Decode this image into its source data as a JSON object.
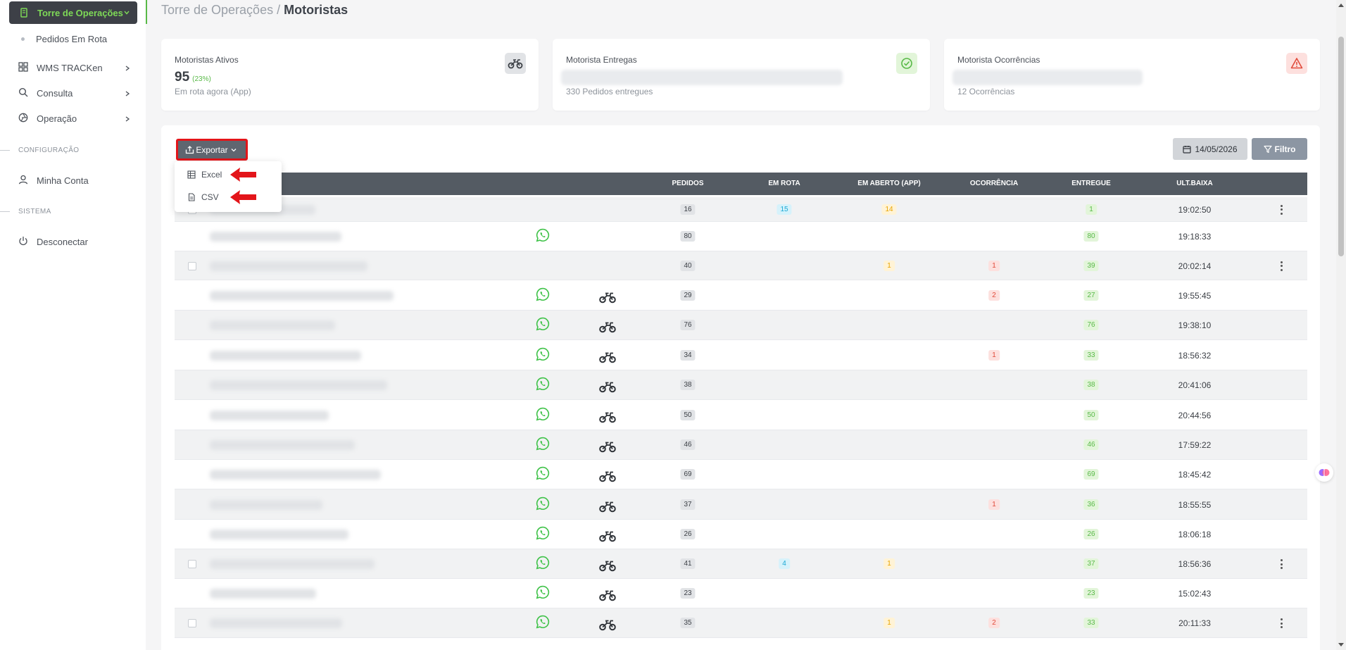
{
  "sidebar": {
    "active_menu": "Torre de Operações",
    "active_sub": "Pedidos Em Rota",
    "items": [
      {
        "label": "WMS TRACKen"
      },
      {
        "label": "Consulta"
      },
      {
        "label": "Operação"
      }
    ],
    "section_config": "CONFIGURAÇÃO",
    "account": "Minha Conta",
    "section_system": "SISTEMA",
    "logout": "Desconectar"
  },
  "breadcrumb": {
    "parent": "Torre de Operações / ",
    "current": "Motoristas"
  },
  "cards": {
    "ativos": {
      "label": "Motoristas Ativos",
      "value": "95",
      "pct": "(23%)",
      "sub": "Em rota agora (App)"
    },
    "entregas": {
      "label": "Motorista Entregas",
      "sub": "330 Pedidos entregues"
    },
    "ocorrencias": {
      "label": "Motorista Ocorrências",
      "sub": "12 Ocorrências"
    }
  },
  "toolbar": {
    "export_label": "Exportar",
    "date_label": "14/05/2026",
    "filter_label": "Filtro"
  },
  "export_menu": {
    "excel": "Excel",
    "csv": "CSV"
  },
  "table": {
    "columns": {
      "pedidos": "PEDIDOS",
      "em_rota": "EM ROTA",
      "em_aberto": "EM ABERTO (APP)",
      "ocorrencia": "OCORRÊNCIA",
      "entregue": "ENTREGUE",
      "ult_baixa": "ULT.BAIXA"
    },
    "rows": [
      {
        "pedidos": "16",
        "em_rota": "15",
        "em_aberto": "14",
        "ocorrencia": "",
        "entregue": "1",
        "ult_baixa": "19:02:50",
        "checkbox": true,
        "whatsapp": false,
        "moto": false,
        "menu": true
      },
      {
        "pedidos": "80",
        "em_rota": "",
        "em_aberto": "",
        "ocorrencia": "",
        "entregue": "80",
        "ult_baixa": "19:18:33",
        "checkbox": false,
        "whatsapp": true,
        "moto": false,
        "menu": false
      },
      {
        "pedidos": "40",
        "em_rota": "",
        "em_aberto": "1",
        "ocorrencia": "1",
        "entregue": "39",
        "ult_baixa": "20:02:14",
        "checkbox": true,
        "whatsapp": false,
        "moto": false,
        "menu": true
      },
      {
        "pedidos": "29",
        "em_rota": "",
        "em_aberto": "",
        "ocorrencia": "2",
        "entregue": "27",
        "ult_baixa": "19:55:45",
        "checkbox": false,
        "whatsapp": true,
        "moto": true,
        "menu": false
      },
      {
        "pedidos": "76",
        "em_rota": "",
        "em_aberto": "",
        "ocorrencia": "",
        "entregue": "76",
        "ult_baixa": "19:38:10",
        "checkbox": false,
        "whatsapp": true,
        "moto": true,
        "menu": false
      },
      {
        "pedidos": "34",
        "em_rota": "",
        "em_aberto": "",
        "ocorrencia": "1",
        "entregue": "33",
        "ult_baixa": "18:56:32",
        "checkbox": false,
        "whatsapp": true,
        "moto": true,
        "menu": false
      },
      {
        "pedidos": "38",
        "em_rota": "",
        "em_aberto": "",
        "ocorrencia": "",
        "entregue": "38",
        "ult_baixa": "20:41:06",
        "checkbox": false,
        "whatsapp": true,
        "moto": true,
        "menu": false
      },
      {
        "pedidos": "50",
        "em_rota": "",
        "em_aberto": "",
        "ocorrencia": "",
        "entregue": "50",
        "ult_baixa": "20:44:56",
        "checkbox": false,
        "whatsapp": true,
        "moto": true,
        "menu": false
      },
      {
        "pedidos": "46",
        "em_rota": "",
        "em_aberto": "",
        "ocorrencia": "",
        "entregue": "46",
        "ult_baixa": "17:59:22",
        "checkbox": false,
        "whatsapp": true,
        "moto": true,
        "menu": false
      },
      {
        "pedidos": "69",
        "em_rota": "",
        "em_aberto": "",
        "ocorrencia": "",
        "entregue": "69",
        "ult_baixa": "18:45:42",
        "checkbox": false,
        "whatsapp": true,
        "moto": true,
        "menu": false
      },
      {
        "pedidos": "37",
        "em_rota": "",
        "em_aberto": "",
        "ocorrencia": "1",
        "entregue": "36",
        "ult_baixa": "18:55:55",
        "checkbox": false,
        "whatsapp": true,
        "moto": true,
        "menu": false
      },
      {
        "pedidos": "26",
        "em_rota": "",
        "em_aberto": "",
        "ocorrencia": "",
        "entregue": "26",
        "ult_baixa": "18:06:18",
        "checkbox": false,
        "whatsapp": true,
        "moto": true,
        "menu": false
      },
      {
        "pedidos": "41",
        "em_rota": "4",
        "em_aberto": "1",
        "ocorrencia": "",
        "entregue": "37",
        "ult_baixa": "18:56:36",
        "checkbox": true,
        "whatsapp": true,
        "moto": true,
        "menu": true
      },
      {
        "pedidos": "23",
        "em_rota": "",
        "em_aberto": "",
        "ocorrencia": "",
        "entregue": "23",
        "ult_baixa": "15:02:43",
        "checkbox": false,
        "whatsapp": true,
        "moto": true,
        "menu": false
      },
      {
        "pedidos": "35",
        "em_rota": "",
        "em_aberto": "1",
        "ocorrencia": "2",
        "entregue": "33",
        "ult_baixa": "20:11:33",
        "checkbox": true,
        "whatsapp": true,
        "moto": true,
        "menu": true
      }
    ]
  },
  "colors": {
    "accent_green": "#58b947",
    "active_menu_bg": "#3d4047",
    "table_header_bg": "#545b63",
    "highlight_red": "#e3151a"
  },
  "icons": {
    "whatsapp": "whatsapp-icon",
    "moto": "motorcycle-icon",
    "menu": "kebab-menu-icon"
  }
}
